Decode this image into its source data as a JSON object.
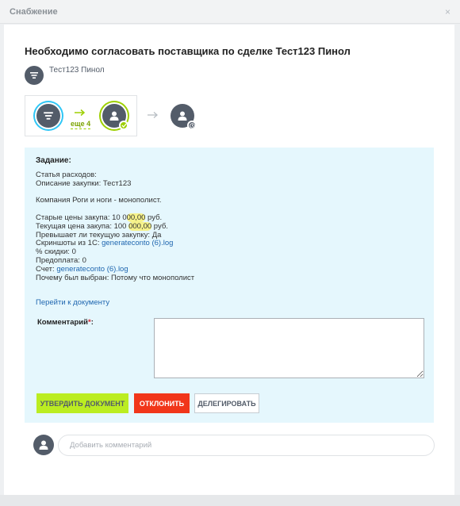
{
  "window": {
    "title": "Снабжение",
    "close_glyph": "×"
  },
  "header": {
    "title": "Необходимо согласовать поставщика по сделке Тест123 Пинол",
    "entity_icon": "filter-icon",
    "entity_name": "Тест123 Пинол"
  },
  "flow": {
    "more_label": "еще 4",
    "nodes": [
      {
        "icon": "filter-icon",
        "state": "current",
        "ring_color": "#2fc6f6"
      },
      {
        "icon": "user-icon",
        "state": "approved",
        "ring_color": "#9dcf00"
      },
      {
        "icon": "user-icon",
        "state": "waiting"
      }
    ]
  },
  "task": {
    "heading": "Задание:",
    "lines": {
      "expense_item": "Статья расходов:",
      "purchase_description": "Описание закупки: Тест123",
      "company": "Компания Роги и ноги - монополист.",
      "old_prices": "Старые цены закупа: 10 000,00 руб.",
      "current_price": "Текущая цена закупа: 100 000,00 руб.",
      "exceeds": "Превышает ли текущую закупку: Да",
      "screenshots_label": "Скриншоты из 1С:",
      "screenshots_link": "generateconto (6).log",
      "discount": "% скидки: 0",
      "prepayment": "Предоплата: 0",
      "invoice_label": "Счет:",
      "invoice_link": "generateconto (6).log",
      "reason": "Почему был выбран: Потому что монополист"
    },
    "doc_link": "Перейти к документу",
    "comment_label": "Комментарий",
    "comment_required_mark": "*",
    "comment_suffix": ":",
    "comment_value": ""
  },
  "buttons": {
    "approve": "УТВЕРДИТЬ ДОКУМЕНТ",
    "reject": "ОТКЛОНИТЬ",
    "delegate": "ДЕЛЕГИРОВАТЬ"
  },
  "comment_bar": {
    "placeholder": "Добавить комментарий"
  },
  "colors": {
    "approve": "#bbed21",
    "reject": "#f1361a",
    "task_background": "#e5f7fd",
    "link": "#2067b0"
  }
}
